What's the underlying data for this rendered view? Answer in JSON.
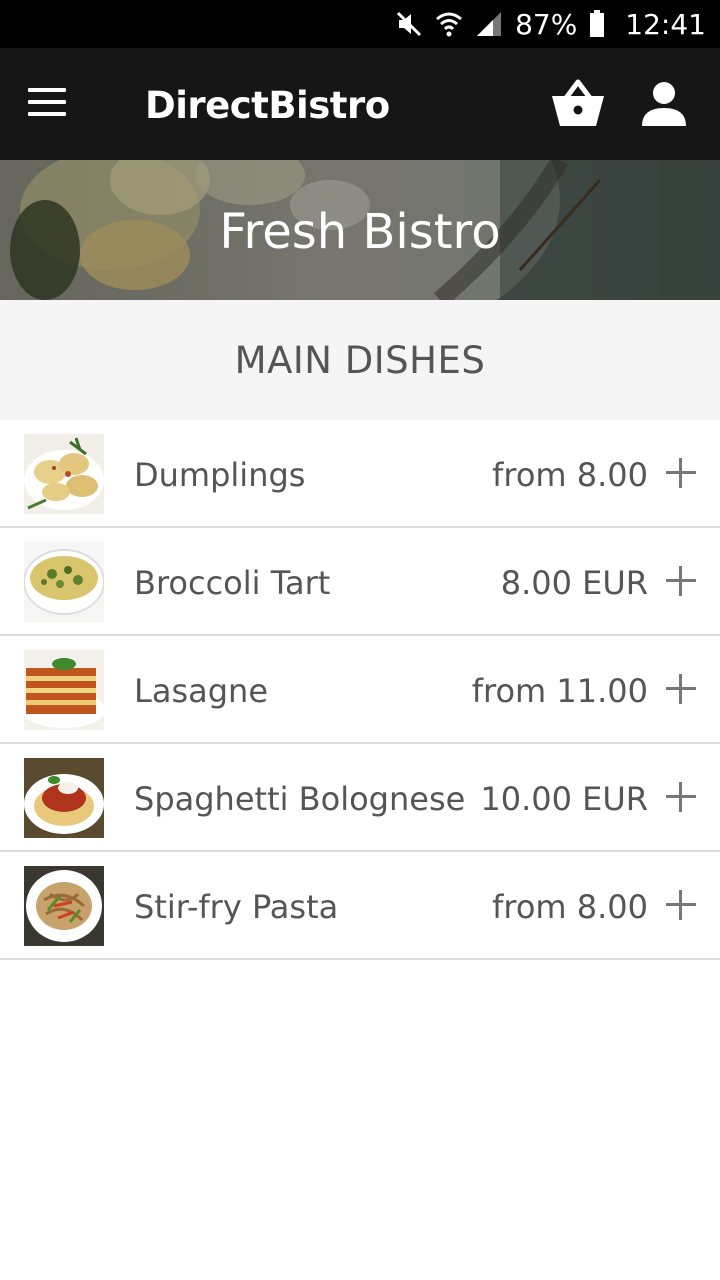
{
  "status_bar": {
    "battery_text": "87%",
    "time": "12:41",
    "icons": [
      "mute-icon",
      "wifi-icon",
      "signal-icon",
      "battery-icon"
    ]
  },
  "app_bar": {
    "title": "DirectBistro",
    "icons": [
      "menu-icon",
      "basket-icon",
      "profile-icon"
    ]
  },
  "hero": {
    "title": "Fresh Bistro"
  },
  "section": {
    "title": "MAIN DISHES"
  },
  "menu_items": [
    {
      "name": "Dumplings",
      "price": "from 8.00",
      "thumb_icon": "dumplings-photo"
    },
    {
      "name": "Broccoli Tart",
      "price": "8.00 EUR",
      "thumb_icon": "broccoli-tart-photo"
    },
    {
      "name": "Lasagne",
      "price": "from 11.00",
      "thumb_icon": "lasagne-photo"
    },
    {
      "name": "Spaghetti Bolognese",
      "price": "10.00 EUR",
      "thumb_icon": "spaghetti-photo"
    },
    {
      "name": "Stir-fry Pasta",
      "price": "from 8.00",
      "thumb_icon": "stir-fry-photo"
    }
  ],
  "colors": {
    "status_bar_bg": "#000000",
    "app_bar_bg": "#161616",
    "section_bg": "#f5f5f5",
    "text": "#555555",
    "divider": "#dddddd"
  }
}
